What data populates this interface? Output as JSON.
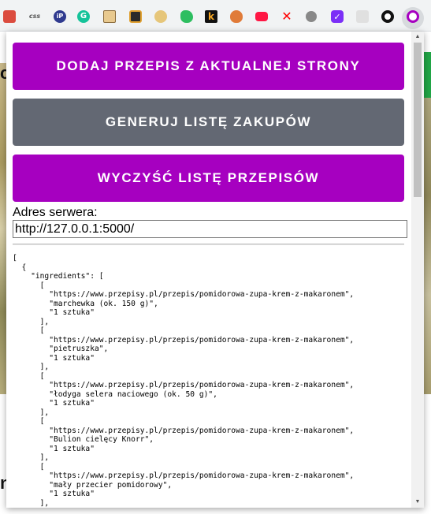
{
  "toolbar": {
    "extensions": [
      {
        "name": "todoist-icon",
        "glyph": "",
        "bg": "#db4c3f",
        "fg": "#ffffff"
      },
      {
        "name": "css-icon",
        "glyph": "css",
        "bg": "",
        "fg": "#555555"
      },
      {
        "name": "ip-icon",
        "glyph": "iP",
        "bg": "#2f3a8f",
        "fg": "#ffffff"
      },
      {
        "name": "grammarly-icon",
        "glyph": "G",
        "bg": "#15c39a",
        "fg": "#ffffff"
      },
      {
        "name": "face-box-icon",
        "glyph": "",
        "bg": "#e8c98f",
        "fg": "#333333"
      },
      {
        "name": "camera-icon",
        "glyph": "",
        "bg": "#2b2b2b",
        "fg": "#e0a030"
      },
      {
        "name": "owl-icon",
        "glyph": "",
        "bg": "#e6c67a",
        "fg": "#333333"
      },
      {
        "name": "evernote-icon",
        "glyph": "",
        "bg": "#2dbe60",
        "fg": "#ffffff"
      },
      {
        "name": "k-icon",
        "glyph": "k",
        "bg": "#111111",
        "fg": "#f5a623"
      },
      {
        "name": "onion-icon",
        "glyph": "",
        "bg": "#e07b39",
        "fg": "#ffffff"
      },
      {
        "name": "youtube-icon",
        "glyph": "",
        "bg": "#ff1744",
        "fg": "#ffffff"
      },
      {
        "name": "close-x-icon",
        "glyph": "✕",
        "bg": "",
        "fg": "#ff0000"
      },
      {
        "name": "circle-gray-icon",
        "glyph": "",
        "bg": "#888888",
        "fg": "#ffffff"
      },
      {
        "name": "check-purple-icon",
        "glyph": "✓",
        "bg": "#7b2ff7",
        "fg": "#ffffff"
      },
      {
        "name": "grid-icon",
        "glyph": "",
        "bg": "#e0e0e0",
        "fg": "#9e9e9e"
      },
      {
        "name": "github-icon",
        "glyph": "",
        "bg": "#ffffff",
        "fg": "#111111"
      },
      {
        "name": "recipe-extension-icon",
        "glyph": "",
        "bg": "#ffffff",
        "fg": "#a600c0"
      }
    ]
  },
  "background": {
    "letter_top": "c",
    "letter_bottom": "n"
  },
  "popup": {
    "add_recipe_label": "DODAJ PRZEPIS Z AKTUALNEJ STRONY",
    "generate_list_label": "GENERUJ LISTĘ ZAKUPÓW",
    "clear_list_label": "WYCZYŚĆ LISTĘ PRZEPISÓW",
    "server_label": "Adres serwera:",
    "server_value": "http://127.0.0.1:5000/",
    "json_output": "[\n  {\n    \"ingredients\": [\n      [\n        \"https://www.przepisy.pl/przepis/pomidorowa-zupa-krem-z-makaronem\",\n        \"marchewka (ok. 150 g)\",\n        \"1 sztuka\"\n      ],\n      [\n        \"https://www.przepisy.pl/przepis/pomidorowa-zupa-krem-z-makaronem\",\n        \"pietruszka\",\n        \"1 sztuka\"\n      ],\n      [\n        \"https://www.przepisy.pl/przepis/pomidorowa-zupa-krem-z-makaronem\",\n        \"łodyga selera naciowego (ok. 50 g)\",\n        \"1 sztuka\"\n      ],\n      [\n        \"https://www.przepisy.pl/przepis/pomidorowa-zupa-krem-z-makaronem\",\n        \"Bulion cielęcy Knorr\",\n        \"1 sztuka\"\n      ],\n      [\n        \"https://www.przepisy.pl/przepis/pomidorowa-zupa-krem-z-makaronem\",\n        \"mały przecier pomidorowy\",\n        \"1 sztuka\"\n      ],\n      ["
  },
  "colors": {
    "purple": "#a600c0",
    "gray": "#636873"
  }
}
